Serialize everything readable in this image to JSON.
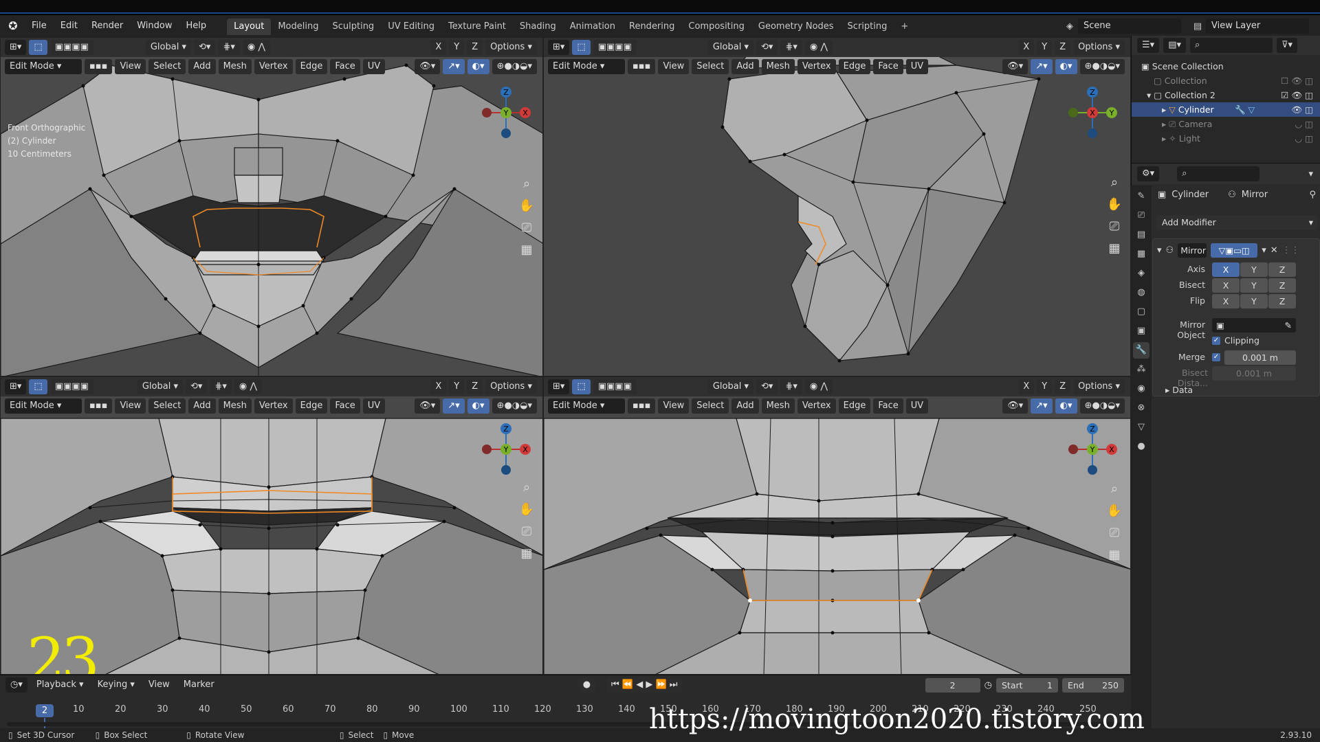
{
  "menubar": {
    "items": [
      "File",
      "Edit",
      "Render",
      "Window",
      "Help"
    ],
    "workspaces": [
      "Layout",
      "Modeling",
      "Sculpting",
      "UV Editing",
      "Texture Paint",
      "Shading",
      "Animation",
      "Rendering",
      "Compositing",
      "Geometry Nodes",
      "Scripting"
    ],
    "active_workspace": "Layout",
    "add_tab": "+",
    "scene": "Scene",
    "view_layer": "View Layer"
  },
  "viewport_header": {
    "orientation": "Global",
    "axis_x": "X",
    "axis_y": "Y",
    "axis_z": "Z",
    "options": "Options",
    "mode": "Edit Mode",
    "menus": [
      "View",
      "Select",
      "Add",
      "Mesh",
      "Vertex",
      "Edge",
      "Face",
      "UV"
    ]
  },
  "viewport_tl": {
    "view_name": "Front Orthographic",
    "object": "(2) Cylinder",
    "scale": "10 Centimeters"
  },
  "gizmo": {
    "x": "X",
    "y": "Y",
    "z": "Z"
  },
  "outliner": {
    "root": "Scene Collection",
    "items": [
      {
        "label": "Collection"
      },
      {
        "label": "Collection 2"
      },
      {
        "label": "Cylinder"
      },
      {
        "label": "Camera"
      },
      {
        "label": "Light"
      }
    ]
  },
  "properties": {
    "object_name": "Cylinder",
    "modifier_tab": "Mirror",
    "add_modifier": "Add Modifier",
    "modifier_name": "Mirror",
    "axis_label": "Axis",
    "bisect_label": "Bisect",
    "flip_label": "Flip",
    "x": "X",
    "y": "Y",
    "z": "Z",
    "mirror_object_label": "Mirror Object",
    "clipping_label": "Clipping",
    "merge_label": "Merge",
    "merge_value": "0.001 m",
    "bisect_distance_label": "Bisect Dista...",
    "bisect_distance_value": "0.001 m",
    "data_label": "Data"
  },
  "timeline": {
    "menus": [
      "Playback",
      "Keying",
      "View",
      "Marker"
    ],
    "current_frame": "2",
    "start_label": "Start",
    "start": "1",
    "end_label": "End",
    "end": "250",
    "ticks": [
      "10",
      "20",
      "30",
      "40",
      "50",
      "60",
      "70",
      "80",
      "90",
      "100",
      "110",
      "120",
      "130",
      "140",
      "150",
      "160",
      "170",
      "180",
      "190",
      "200",
      "210",
      "220",
      "230",
      "240",
      "250"
    ]
  },
  "statusbar": {
    "hint1": "Set 3D Cursor",
    "hint2": "Box Select",
    "hint3": "Rotate View",
    "hint4": "Select",
    "hint5": "Move",
    "version": "2.93.10"
  },
  "overlay": {
    "episode": "23",
    "watermark": "https://movingtoon2020.tistory.com"
  },
  "colors": {
    "accent": "#476aa8",
    "selection": "#f08a24",
    "selected_row": "#334d80"
  }
}
